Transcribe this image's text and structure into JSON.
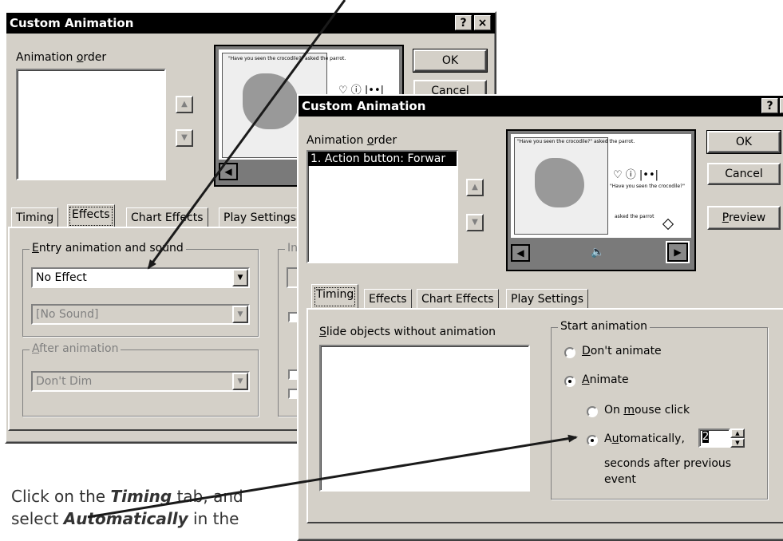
{
  "back_dialog": {
    "title": "Custom Animation",
    "help_btn": "?",
    "close_btn": "×",
    "animation_order_label": "Animation order",
    "ok": "OK",
    "cancel": "Cancel",
    "tabs": [
      "Timing",
      "Effects",
      "Chart Effects",
      "Play Settings"
    ],
    "entry_group_label": "Entry animation and sound",
    "entry_effect": "No Effect",
    "sound": "[No Sound]",
    "after_group_label": "After animation",
    "after_value": "Don't Dim",
    "intro_group_label": "In"
  },
  "front_dialog": {
    "title": "Custom Animation",
    "help_btn": "?",
    "close_btn": "×",
    "animation_order_label": "Animation order",
    "order_items": [
      "1. Action button: Forwar"
    ],
    "ok": "OK",
    "cancel": "Cancel",
    "preview": "Preview",
    "tabs": [
      "Timing",
      "Effects",
      "Chart Effects",
      "Play Settings"
    ],
    "slide_objects_label": "Slide objects without animation",
    "start_group_label": "Start animation",
    "radio_dont_animate": "Don't animate",
    "radio_animate": "Animate",
    "radio_on_click": "On mouse click",
    "radio_automatically": "Automatically,",
    "seconds_value": "2",
    "seconds_text_1": "seconds after previous",
    "seconds_text_2": "event"
  },
  "slide_thumb": {
    "quote": "\"Have you seen the crocodile?\" asked the parrot.",
    "caption_1": "\"Have you seen the crocodile?\"",
    "caption_2": "asked the parrot"
  },
  "instruction": {
    "line1_pre": "Click on the ",
    "line1_bold": "Timing",
    "line1_post": " tab, and",
    "line2_pre": "select ",
    "line2_bold": "Automatically",
    "line2_post": " in the"
  },
  "colors": {
    "dialog_bg": "#d4d0c8",
    "titlebar": "#000000",
    "arrow": "#1a1a1a"
  }
}
